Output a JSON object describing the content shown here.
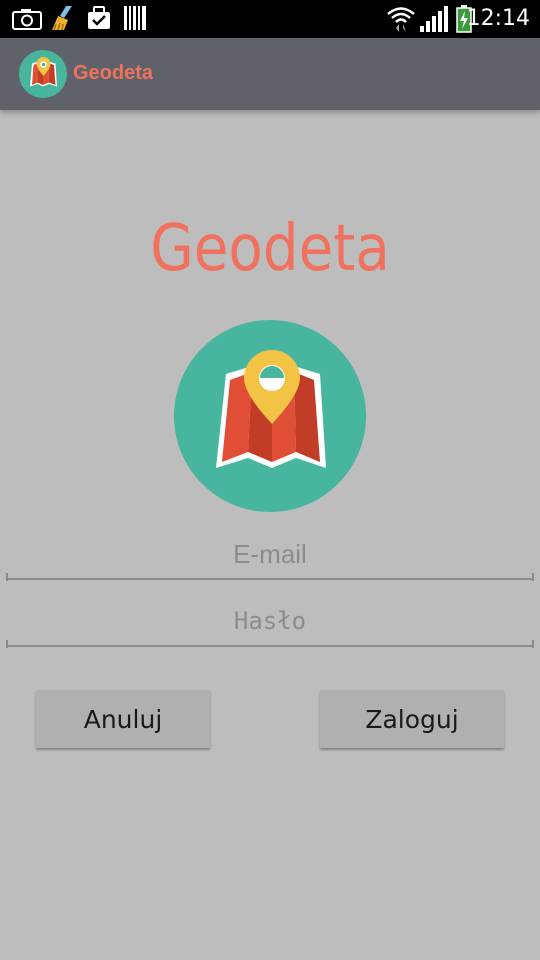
{
  "status_bar": {
    "time": "12:14",
    "icons": [
      "camera-icon",
      "cleaner-icon",
      "briefcase-check-icon",
      "barcode-icon",
      "wifi-icon",
      "signal-icon",
      "battery-charging-icon"
    ]
  },
  "action_bar": {
    "title": "Geodeta",
    "icon": "map-pin-icon"
  },
  "main": {
    "title": "Geodeta",
    "logo": "map-pin-icon",
    "email_placeholder": "E-mail",
    "password_placeholder": "Hasło",
    "cancel_label": "Anuluj",
    "login_label": "Zaloguj"
  },
  "colors": {
    "accent": "#f0725e",
    "action_bar": "#5f6269",
    "background": "#bdbdbd",
    "logo_circle": "#48b59e",
    "map_red": "#e04e35",
    "pin_yellow": "#f2c344"
  }
}
